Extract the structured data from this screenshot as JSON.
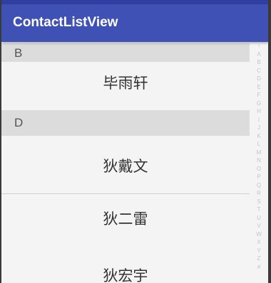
{
  "app_bar": {
    "title": "ContactListView"
  },
  "sections": [
    {
      "letter": "B",
      "contacts": [
        "毕雨轩"
      ]
    },
    {
      "letter": "D",
      "contacts": [
        "狄戴文",
        "狄二雷",
        "狄宏宇"
      ]
    }
  ],
  "index_bar": {
    "letters": [
      "↑",
      "A",
      "B",
      "C",
      "D",
      "E",
      "F",
      "G",
      "H",
      "I",
      "J",
      "K",
      "L",
      "M",
      "N",
      "O",
      "P",
      "Q",
      "R",
      "S",
      "T",
      "U",
      "V",
      "W",
      "X",
      "Y",
      "Z",
      "#"
    ]
  },
  "colors": {
    "app_bar": "#3f51b5",
    "status_bar": "#303f9f",
    "section_header": "#dcdcdc",
    "list_background": "#f4f4f4"
  }
}
